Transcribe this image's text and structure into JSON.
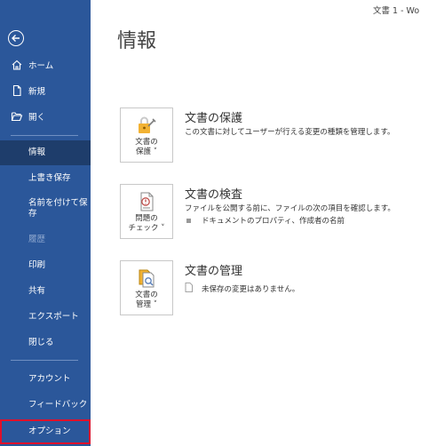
{
  "titlebar": {
    "text": "文書 1  -  Wo"
  },
  "sidebar": {
    "top_items": [
      {
        "label": "ホーム",
        "icon": "home-icon"
      },
      {
        "label": "新規",
        "icon": "new-document-icon"
      },
      {
        "label": "開く",
        "icon": "folder-open-icon"
      }
    ],
    "items": [
      {
        "label": "情報",
        "state": "active"
      },
      {
        "label": "上書き保存"
      },
      {
        "label": "名前を付けて保\n存"
      },
      {
        "label": "履歴",
        "state": "disabled"
      },
      {
        "label": "印刷"
      },
      {
        "label": "共有"
      },
      {
        "label": "エクスポート"
      },
      {
        "label": "閉じる"
      },
      {
        "label": "アカウント"
      },
      {
        "label": "フィードバック"
      },
      {
        "label": "オプション",
        "state": "highlighted"
      }
    ]
  },
  "main": {
    "title": "情報",
    "sections": [
      {
        "tile_label_1": "文書の",
        "tile_label_2": "保護 ˅",
        "title": "文書の保護",
        "desc": "この文書に対してユーザーが行える変更の種類を管理します。",
        "icon": "lock-icon",
        "accent": "#f2b233"
      },
      {
        "tile_label_1": "問題の",
        "tile_label_2": "チェック ˅",
        "title": "文書の検査",
        "desc": "ファイルを公開する前に、ファイルの次の項目を確認します。",
        "bullet": "ドキュメントのプロパティ、作成者の名前",
        "icon": "inspect-document-icon",
        "accent": "#c0504d"
      },
      {
        "tile_label_1": "文書の",
        "tile_label_2": "管理 ˅",
        "title": "文書の管理",
        "bullet": "未保存の変更はありません。",
        "icon": "manage-document-icon",
        "accent": "#f2b233"
      }
    ]
  }
}
